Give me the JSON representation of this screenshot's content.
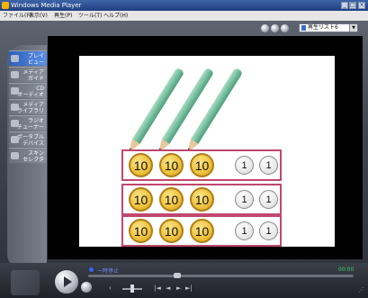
{
  "window": {
    "title": "Windows Media Player",
    "controls": [
      "_",
      "□",
      "×"
    ]
  },
  "menu": [
    "ファイル(F)",
    "表示(V)",
    "再生(P)",
    "ツール(T)",
    "ヘルプ(H)"
  ],
  "sidebar": {
    "items": [
      {
        "label_line1": "プレイ",
        "label_line2": "ビュー",
        "icon": "now-playing-icon",
        "active": true
      },
      {
        "label_line1": "メディア",
        "label_line2": "ガイド",
        "icon": "media-guide-icon",
        "active": false
      },
      {
        "label_line1": "CD",
        "label_line2": "オーディオ",
        "icon": "cd-audio-icon",
        "active": false
      },
      {
        "label_line1": "メディア",
        "label_line2": "ライブラリ",
        "icon": "media-library-icon",
        "active": false
      },
      {
        "label_line1": "ラジオ",
        "label_line2": "チューナー",
        "icon": "radio-tuner-icon",
        "active": false
      },
      {
        "label_line1": "ポータブル",
        "label_line2": "デバイス",
        "icon": "portable-device-icon",
        "active": false
      },
      {
        "label_line1": "スキン",
        "label_line2": "セレクタ",
        "icon": "skin-chooser-icon",
        "active": false
      }
    ]
  },
  "toolbar": {
    "playlist_value": "再生リスト6"
  },
  "video": {
    "pencil_count": 3,
    "coin_rows": [
      {
        "tens": [
          "10",
          "10",
          "10"
        ],
        "ones": [
          "1",
          "1"
        ]
      },
      {
        "tens": [
          "10",
          "10",
          "10"
        ],
        "ones": [
          "1",
          "1"
        ]
      },
      {
        "tens": [
          "10",
          "10",
          "10"
        ],
        "ones": [
          "1",
          "1"
        ]
      }
    ]
  },
  "status": {
    "text": "一時停止",
    "time": "00:00"
  },
  "colors": {
    "accent": "#3b63ff",
    "frame": "#cc4477",
    "ten_coin": "#eec23c",
    "one_coin": "#e6e6e6"
  }
}
